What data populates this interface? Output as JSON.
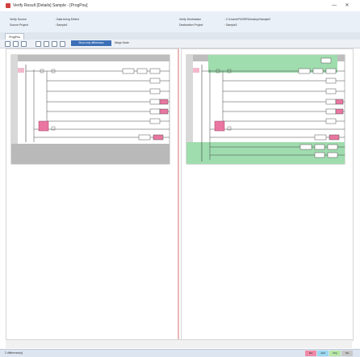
{
  "window": {
    "title": "Verify Result [Details] Sample - [ProgPou]",
    "minimize": "—",
    "close": "✕"
  },
  "info": {
    "verify_source_label": "Verify Source",
    "verify_source_value": ": Data being Edited",
    "source_project_label": "Source Project",
    "source_project_value": ": Sample1",
    "verify_destination_label": "Verify Destination",
    "verify_destination_value": ": C:\\Users\\PUSER\\Desktop\\Sample2",
    "destination_project_label": "Destination Project",
    "destination_project_value": ": Sample2"
  },
  "tabs": [
    {
      "label": "ProgPou"
    }
  ],
  "toolbar": {
    "selected_label": "Show only differences",
    "merge_label": "Merge Mode"
  },
  "status": {
    "left_text": "2 difference(s)"
  },
  "legend": [
    {
      "label": "Del",
      "color": "#f08aa8"
    },
    {
      "label": "Add",
      "color": "#9ad8f0"
    },
    {
      "label": "Chg",
      "color": "#b8e6a8"
    },
    {
      "label": "Del",
      "color": "#c8c8c8"
    }
  ],
  "colors": {
    "deleted": "#e876a0",
    "changed": "#9fdcae",
    "unchanged": "#ffffff",
    "gray_area": "#b9b9b9"
  }
}
